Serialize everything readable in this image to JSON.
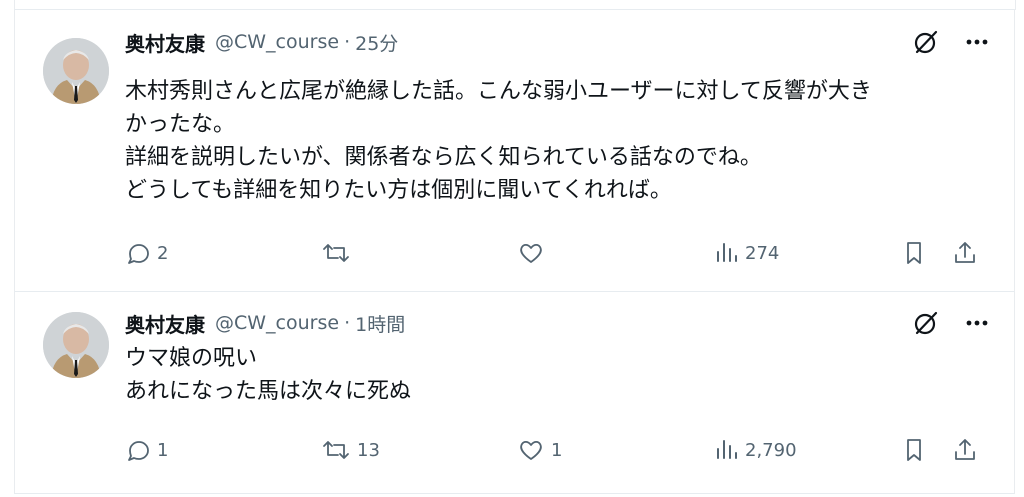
{
  "colors": {
    "text": "#0f1419",
    "secondary": "#536471",
    "border": "#e7ecf0"
  },
  "tweets": [
    {
      "author": "奥村友康",
      "handle": "@CW_course",
      "separator": "·",
      "time": "25分",
      "lines": [
        "木村秀則さんと広尾が絶縁した話。こんな弱小ユーザーに対して反響が大き",
        "かったな。",
        "詳細を説明したいが、関係者なら広く知られている話なのでね。",
        "どうしても詳細を知りたい方は個別に聞いてくれれば。"
      ],
      "replies": "2",
      "reposts": "",
      "likes": "",
      "views": "274",
      "icons": [
        "grok-icon",
        "more-icon",
        "reply-icon",
        "repost-icon",
        "like-icon",
        "views-icon",
        "bookmark-icon",
        "share-icon"
      ]
    },
    {
      "author": "奥村友康",
      "handle": "@CW_course",
      "separator": "·",
      "time": "1時間",
      "lines": [
        "ウマ娘の呪い",
        "あれになった馬は次々に死ぬ"
      ],
      "replies": "1",
      "reposts": "13",
      "likes": "1",
      "views": "2,790",
      "icons": [
        "grok-icon",
        "more-icon",
        "reply-icon",
        "repost-icon",
        "like-icon",
        "views-icon",
        "bookmark-icon",
        "share-icon"
      ]
    }
  ]
}
